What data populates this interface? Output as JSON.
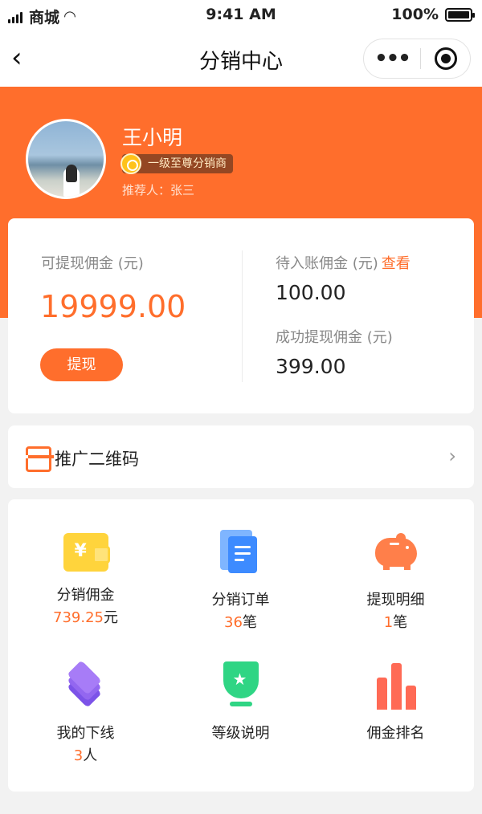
{
  "status_bar": {
    "carrier": "商城",
    "time": "9:41 AM",
    "battery": "100%"
  },
  "nav": {
    "title": "分销中心",
    "back_icon": "back-icon"
  },
  "profile": {
    "name": "王小明",
    "level": "一级至尊分销商",
    "referrer": "推荐人：张三"
  },
  "earnings": {
    "withdrawable_label": "可提现佣金 (元)",
    "withdrawable_amount": "19999.00",
    "withdraw_button": "提现",
    "pending_label": "待入账佣金 (元)",
    "pending_link": "查看",
    "pending_amount": "100.00",
    "withdrawn_label": "成功提现佣金 (元)",
    "withdrawn_amount": "399.00"
  },
  "qr": {
    "label": "推广二维码",
    "icon": "qrcode-scan-icon"
  },
  "grid": [
    {
      "label": "分销佣金",
      "value": "739.25",
      "unit": "元",
      "icon": "wallet-icon"
    },
    {
      "label": "分销订单",
      "value": "36",
      "unit": "笔",
      "icon": "document-icon"
    },
    {
      "label": "提现明细",
      "value": "1",
      "unit": "笔",
      "icon": "piggy-bank-icon"
    },
    {
      "label": "我的下线",
      "value": "3",
      "unit": "人",
      "icon": "layers-icon"
    },
    {
      "label": "等级说明",
      "icon": "star-badge-icon"
    },
    {
      "label": "佣金排名",
      "icon": "bar-chart-icon"
    }
  ],
  "colors": {
    "accent": "#ff6e2c",
    "background": "#f2f2f2"
  }
}
